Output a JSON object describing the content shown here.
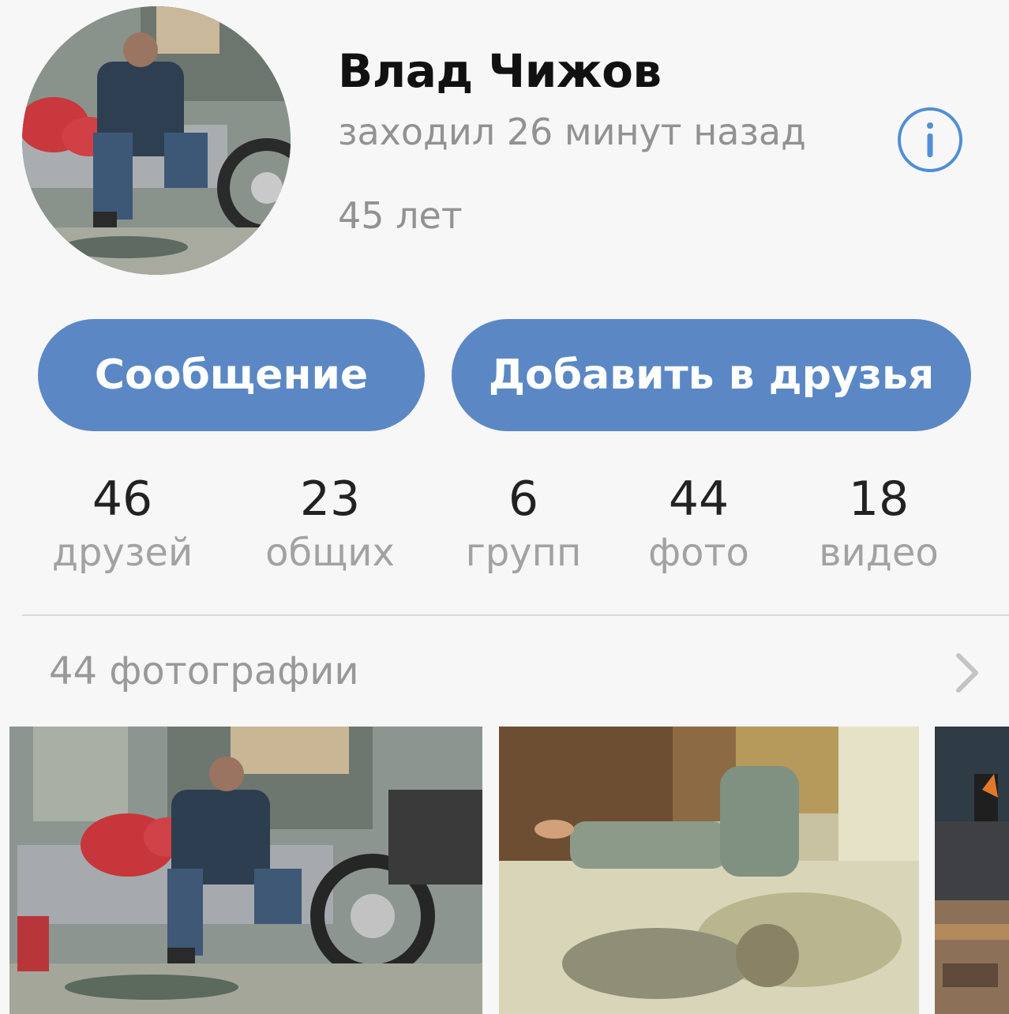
{
  "profile": {
    "name": "Влад Чижов",
    "status": "заходил 26 минут назад",
    "age": "45 лет",
    "info_icon": "info-icon",
    "accent_color": "#5b88c5"
  },
  "actions": {
    "message_label": "Сообщение",
    "add_friend_label": "Добавить в друзья"
  },
  "stats": [
    {
      "value": "46",
      "label": "друзей"
    },
    {
      "value": "23",
      "label": "общих"
    },
    {
      "value": "6",
      "label": "групп"
    },
    {
      "value": "44",
      "label": "фото"
    },
    {
      "value": "18",
      "label": "видео"
    }
  ],
  "photos": {
    "title": "44 фотографии",
    "chevron_icon": "chevron-right-icon"
  }
}
